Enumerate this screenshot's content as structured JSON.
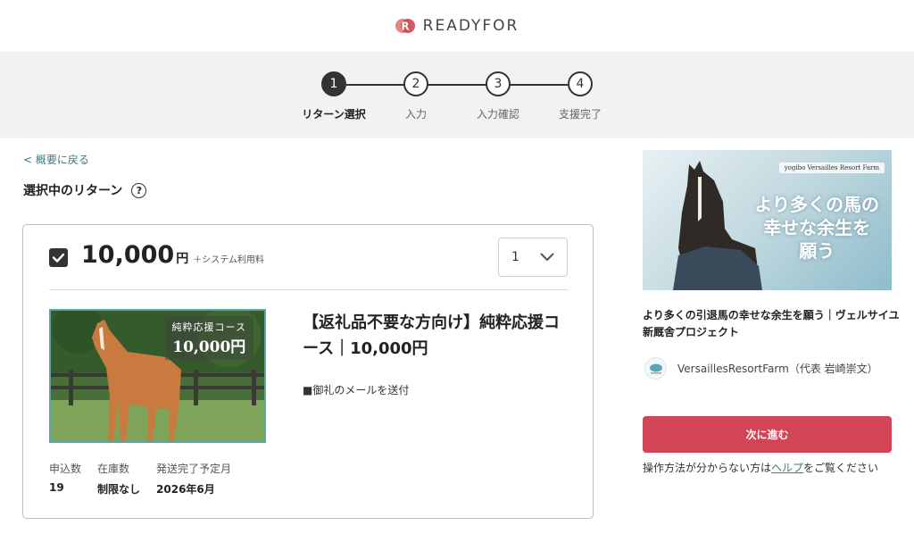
{
  "header": {
    "brand": "READYFOR"
  },
  "steps": [
    {
      "num": "1",
      "label": "リターン選択"
    },
    {
      "num": "2",
      "label": "入力"
    },
    {
      "num": "3",
      "label": "入力確認"
    },
    {
      "num": "4",
      "label": "支援完了"
    }
  ],
  "active_step": 1,
  "nav": {
    "back_label": "< 概要に戻る"
  },
  "section": {
    "title": "選択中のリターン",
    "help_symbol": "?"
  },
  "course": {
    "price": "10,000",
    "currency": "円",
    "fee_note": "＋システム利用料",
    "quantity": "1",
    "image_badge_line1": "純粋応援コース",
    "image_badge_line2": "10,000円",
    "title": "【返礼品不要な方向け】純粋応援コース｜10,000円",
    "description": "■御礼のメールを送付",
    "stats": [
      {
        "label": "申込数",
        "value": "19"
      },
      {
        "label": "在庫数",
        "value": "制限なし"
      },
      {
        "label": "発送完了予定月",
        "value": "2026年6月"
      }
    ]
  },
  "sidebar": {
    "banner_logo": "yogibo  Versailles Resort Farm",
    "banner_text_line1": "より多くの馬の",
    "banner_text_line2": "幸せな余生を",
    "banner_text_line3": "願う",
    "project_title": "より多くの引退馬の幸せな余生を願う｜ヴェルサイユ新厩舎プロジェクト",
    "owner": "VersaillesResortFarm（代表 岩崎崇文）",
    "next_button": "次に進む",
    "help_prefix": "操作方法が分からない方は",
    "help_link": "ヘルプ",
    "help_suffix": "をご覧ください"
  },
  "colors": {
    "accent": "#d14556",
    "link": "#3a7d7c",
    "stepbar_bg": "#f2f3f1"
  }
}
